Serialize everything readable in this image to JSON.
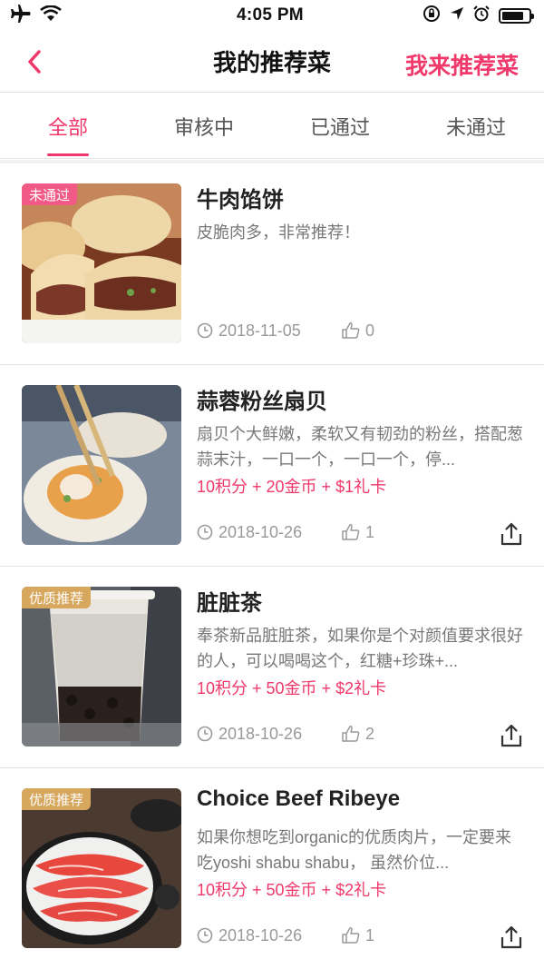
{
  "status_bar": {
    "time": "4:05 PM"
  },
  "nav": {
    "title": "我的推荐菜",
    "action": "我来推荐菜"
  },
  "tabs": [
    {
      "label": "全部",
      "active": true
    },
    {
      "label": "审核中",
      "active": false
    },
    {
      "label": "已通过",
      "active": false
    },
    {
      "label": "未通过",
      "active": false
    }
  ],
  "items": [
    {
      "badge": "未通过",
      "title": "牛肉馅饼",
      "description": "皮脆肉多，非常推荐！",
      "rewards": "",
      "date": "2018-11-05",
      "likes": "0",
      "thumb_icon": "beef-pie-photo"
    },
    {
      "badge": "",
      "title": "蒜蓉粉丝扇贝",
      "description": "扇贝个大鲜嫩，柔软又有韧劲的粉丝，搭配葱蒜末汁，一口一个，一口一个，停...",
      "rewards": "10积分 + 20金币 + $1礼卡",
      "date": "2018-10-26",
      "likes": "1",
      "thumb_icon": "scallop-photo"
    },
    {
      "badge": "优质推荐",
      "title": "脏脏茶",
      "description": "奉茶新品脏脏茶，如果你是个对颜值要求很好的人，可以喝喝这个，红糖+珍珠+...",
      "rewards": "10积分 + 50金币 + $2礼卡",
      "date": "2018-10-26",
      "likes": "2",
      "thumb_icon": "milk-tea-photo"
    },
    {
      "badge": "优质推荐",
      "title": "Choice Beef Ribeye",
      "description": "如果你想吃到organic的优质肉片，一定要来吃yoshi shabu shabu， 虽然价位...",
      "rewards": "10积分 + 50金币 + $2礼卡",
      "date": "2018-10-26",
      "likes": "1",
      "thumb_icon": "ribeye-photo"
    }
  ],
  "colors": {
    "accent": "#f0386b",
    "badge_rejected": "#f15a86",
    "badge_quality": "#d7a75d"
  }
}
